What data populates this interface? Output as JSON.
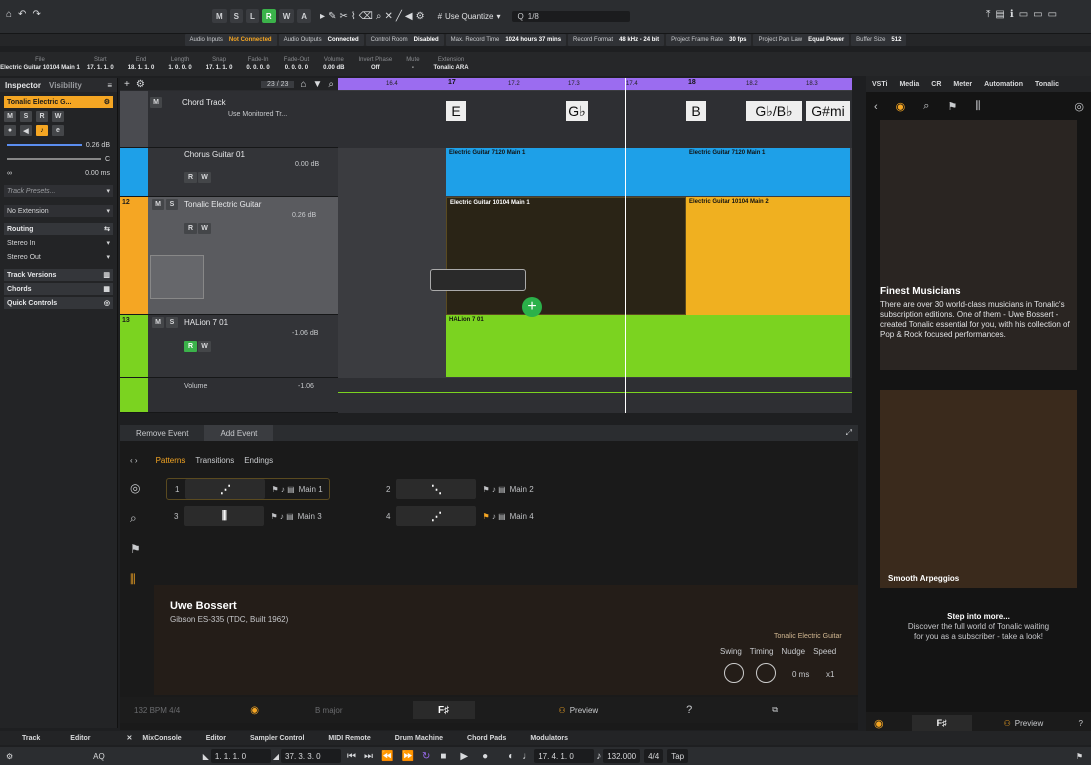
{
  "toolbar": {
    "mode_buttons": [
      "M",
      "S",
      "L",
      "R",
      "W",
      "A"
    ],
    "quantize_label": "Use Quantize",
    "grid_value": "1/8"
  },
  "status": {
    "audio_inputs": "Audio Inputs",
    "audio_inputs_val": "Not Connected",
    "audio_outputs": "Audio Outputs",
    "audio_outputs_val": "Connected",
    "control_room": "Control Room",
    "control_room_val": "Disabled",
    "max_rec": "Max. Record Time",
    "max_rec_val": "1024 hours 37 mins",
    "rec_format": "Record Format",
    "rec_format_val": "48 kHz - 24 bit",
    "frame_rate": "Project Frame Rate",
    "frame_rate_val": "30 fps",
    "pan_law": "Project Pan Law",
    "pan_law_val": "Equal Power",
    "buffer": "Buffer Size",
    "buffer_val": "512"
  },
  "info": {
    "file_l": "File",
    "file_v": "Electric Guitar 10104 Main 1",
    "start_l": "Start",
    "start_v": "17. 1. 1. 0",
    "end_l": "End",
    "end_v": "18. 1. 1. 0",
    "length_l": "Length",
    "length_v": "1. 0. 0. 0",
    "snap_l": "Snap",
    "snap_v": "17. 1. 1. 0",
    "fadein_l": "Fade-In",
    "fadein_v": "0. 0. 0. 0",
    "fadeout_l": "Fade-Out",
    "fadeout_v": "0. 0. 0. 0",
    "volume_l": "Volume",
    "volume_v": "0.00",
    "volume_u": "dB",
    "invert_l": "Invert Phase",
    "invert_v": "Off",
    "mute_l": "Mute",
    "mute_v": "-",
    "ext_l": "Extension",
    "ext_v": "Tonalic ARA"
  },
  "inspector": {
    "tab1": "Inspector",
    "tab2": "Visibility",
    "track": "Tonalic Electric G...",
    "vol": "0.26 dB",
    "pan": "C",
    "delay": "0.00 ms",
    "presets": "Track Presets...",
    "no_ext": "No Extension",
    "routing": "Routing",
    "in": "Stereo In",
    "out": "Stereo Out",
    "versions": "Track Versions",
    "chords": "Chords",
    "quick": "Quick Controls"
  },
  "tracklist": {
    "counter": "23 / 23",
    "chord": "Chord Track",
    "chord_opt": "Use Monitored Tr...",
    "chorus": "Chorus Guitar 01",
    "chorus_vol": "0.00 dB",
    "tonalic_num": "12",
    "tonalic": "Tonalic Electric Guitar",
    "tonalic_vol": "0.26 dB",
    "halion_num": "13",
    "halion": "HALion 7 01",
    "halion_vol": "-1.06 dB",
    "auto_param": "Volume",
    "auto_val": "-1.06"
  },
  "ruler": {
    "m1": "16.4",
    "m2": "17",
    "m3": "17.2",
    "m4": "17.3",
    "m5": "17.4",
    "m6": "18",
    "m7": "18.2",
    "m8": "18.3"
  },
  "chords": {
    "c1": "E",
    "c2": "G♭",
    "c3": "B",
    "c4": "G♭/B♭",
    "c5": "G#mi"
  },
  "events": {
    "e1": "Electric Guitar 10104 Main 1",
    "e2": "Electric Guitar 10104 Main 2",
    "e3": "Electric Guitar 7120 Main 1",
    "e4": "Electric Guitar 7120 Main 1",
    "e5": "HALion 7 01"
  },
  "lower": {
    "remove": "Remove Event",
    "add": "Add Event",
    "tab_patterns": "Patterns",
    "tab_trans": "Transitions",
    "tab_endings": "Endings",
    "p1n": "1",
    "p1": "Main 1",
    "p2n": "2",
    "p2": "Main 2",
    "p3n": "3",
    "p3": "Main 3",
    "p4n": "4",
    "p4": "Main 4",
    "artist": "Uwe Bossert",
    "guitar": "Gibson ES-335 (TDC, Built 1962)",
    "product": "Tonalic Electric Guitar",
    "swing": "Swing",
    "timing": "Timing",
    "nudge": "Nudge",
    "speed": "Speed",
    "nudge_v": "0 ms",
    "speed_v": "x1",
    "bpm": "132 BPM 4/4",
    "key": "B major",
    "chord": "F♯",
    "preview": "Preview",
    "help": "?"
  },
  "right": {
    "tabs": [
      "VSTi",
      "Media",
      "CR",
      "Meter",
      "Automation",
      "Tonalic"
    ],
    "hero_title": "Finest Musicians",
    "hero_text": "There are over 30 world-class musicians in Tonalic's subscription editions. One of them - Uwe Bossert - created Tonalic essential for you, with his collection of Pop & Rock focused performances.",
    "card_title": "Smooth Arpeggios",
    "step_title": "Step into more...",
    "step_text": "Discover the full world of Tonalic waiting for you as a subscriber - take a look!",
    "chord": "F♯",
    "preview": "Preview",
    "help": "?"
  },
  "bottomtabs": {
    "track": "Track",
    "editor": "Editor",
    "mix": "MixConsole",
    "editor2": "Editor",
    "sampler": "Sampler Control",
    "midi": "MIDI Remote",
    "drum": "Drum Machine",
    "pads": "Chord Pads",
    "mod": "Modulators"
  },
  "transport": {
    "aq": "AQ",
    "left": "1. 1. 1. 0",
    "right": "37. 3. 3. 0",
    "pos": "17. 4. 1. 0",
    "tempo": "132.000",
    "sig": "4/4",
    "tap": "Tap"
  },
  "colors": {
    "accent": "#f5a623",
    "blue": "#1ea0e8",
    "green": "#7bd320",
    "purple": "#a06cf0"
  }
}
